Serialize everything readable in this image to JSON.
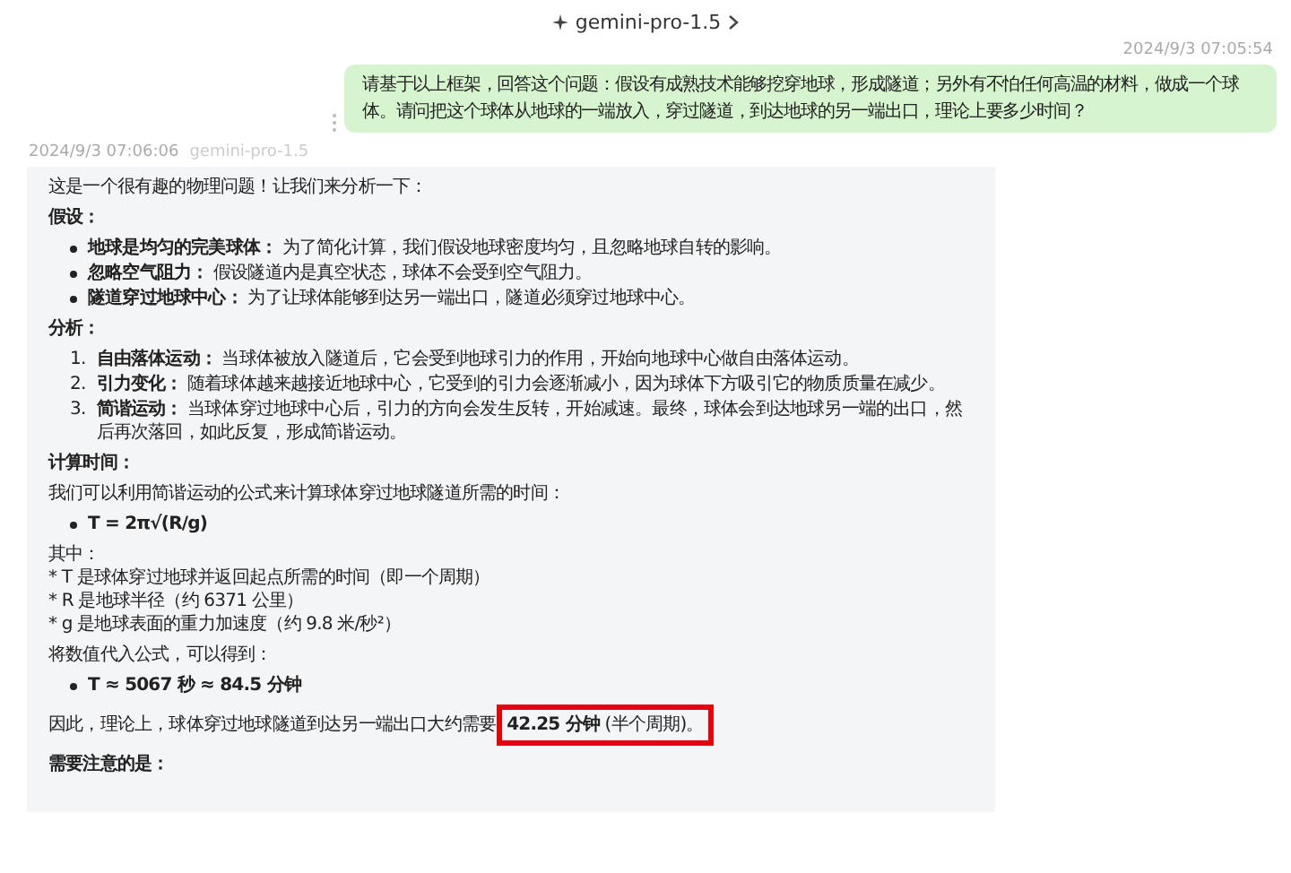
{
  "header": {
    "model": "gemini-pro-1.5"
  },
  "user_message": {
    "timestamp": "2024/9/3 07:05:54",
    "text": "请基于以上框架，回答这个问题：假设有成熟技术能够挖穿地球，形成隧道；另外有不怕任何高温的材料，做成一个球体。请问把这个球体从地球的一端放入，穿过隧道，到达地球的另一端出口，理论上要多少时间？"
  },
  "response": {
    "timestamp": "2024/9/3 07:06:06",
    "model": "gemini-pro-1.5",
    "blocks": [
      {
        "kind": "paragraph",
        "text": "这是一个很有趣的物理问题！让我们来分析一下："
      },
      {
        "kind": "heading",
        "text": "假设："
      },
      {
        "kind": "bullets",
        "items": [
          {
            "text": "**地球是均匀的完美球体：** 为了简化计算，我们假设地球密度均匀，且忽略地球自转的影响。"
          },
          {
            "text": "**忽略空气阻力：** 假设隧道内是真空状态，球体不会受到空气阻力。"
          },
          {
            "text": "**隧道穿过地球中心：** 为了让球体能够到达另一端出口，隧道必须穿过地球中心。"
          }
        ]
      },
      {
        "kind": "heading",
        "text": "分析："
      },
      {
        "kind": "numbered",
        "items": [
          {
            "number": "1.",
            "text": "**自由落体运动：** 当球体被放入隧道后，它会受到地球引力的作用，开始向地球中心做自由落体运动。"
          },
          {
            "number": "2.",
            "text": "**引力变化：** 随着球体越来越接近地球中心，它受到的引力会逐渐减小，因为球体下方吸引它的物质质量在减少。"
          },
          {
            "number": "3.",
            "text": "**简谐运动：** 当球体穿过地球中心后，引力的方向会发生反转，开始减速。最终，球体会到达地球另一端的出口，然后再次落回，如此反复，形成简谐运动。"
          }
        ]
      },
      {
        "kind": "heading",
        "text": "计算时间："
      },
      {
        "kind": "paragraph",
        "text": "我们可以利用简谐运动的公式来计算球体穿过地球隧道所需的时间："
      },
      {
        "kind": "formula",
        "items": [
          {
            "text": "T = 2π√(R/g)"
          }
        ]
      },
      {
        "kind": "lines",
        "items": [
          {
            "text": "其中："
          },
          {
            "text": "* T 是球体穿过地球并返回起点所需的时间（即一个周期）"
          },
          {
            "text": "* R 是地球半径（约 6371 公里）"
          },
          {
            "text": "* g 是地球表面的重力加速度（约 9.8 米/秒²）"
          }
        ]
      },
      {
        "kind": "paragraph",
        "text": "将数值代入公式，可以得到："
      },
      {
        "kind": "formula",
        "items": [
          {
            "text": "T ≈ 5067 秒 ≈ 84.5 分钟"
          }
        ]
      },
      {
        "kind": "highlighted_paragraph",
        "text": "因此，理论上，球体穿过地球隧道到达另一端出口大约需要",
        "highlight": "**42.25 分钟** (半个周期)。"
      },
      {
        "kind": "heading",
        "text": "需要注意的是："
      }
    ]
  }
}
